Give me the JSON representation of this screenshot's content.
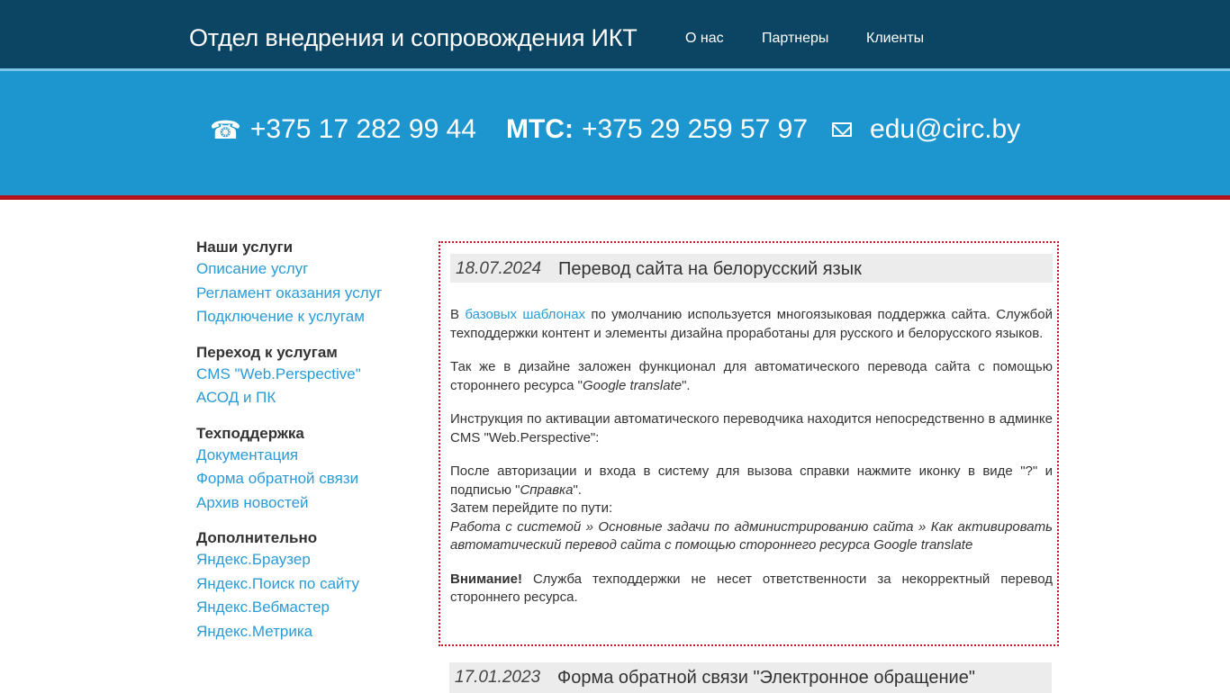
{
  "header": {
    "site_title": "Отдел внедрения и сопровождения ИКТ",
    "nav": [
      "О нас",
      "Партнеры",
      "Клиенты"
    ]
  },
  "contacts": {
    "phone": "+375 17 282 99 44",
    "mts_label": "МТС:",
    "mts_phone": "+375 29 259 57 97",
    "email": "edu@circ.by",
    "icons": [
      "phone-icon",
      "mail-icon"
    ]
  },
  "sidebar": {
    "groups": [
      {
        "heading": "Наши услуги",
        "links": [
          "Описание услуг",
          "Регламент оказания услуг",
          "Подключение к услугам"
        ]
      },
      {
        "heading": "Переход к услугам",
        "links": [
          "CMS \"Web.Perspective\"",
          "АСОД и ПК"
        ]
      },
      {
        "heading": "Техподдержка",
        "links": [
          "Документация",
          "Форма обратной связи",
          "Архив новостей"
        ]
      },
      {
        "heading": "Дополнительно",
        "links": [
          "Яндекс.Браузер",
          "Яндекс.Поиск по сайту",
          "Яндекс.Вебмастер",
          "Яндекс.Метрика"
        ]
      }
    ]
  },
  "news": [
    {
      "date": "18.07.2024",
      "title": "Перевод сайта на белорусский язык",
      "p1_pre": "В ",
      "p1_link": "базовых шаблонах",
      "p1_post": " по умолчанию используется многоязыковая поддержка сайта. Службой техподдержки контент и элементы дизайна проработаны для русского и белорусского языков.",
      "p2_pre": "Так же в дизайне заложен функционал для автоматического перевода сайта с помощью стороннего ресурса \"",
      "p2_em": "Google translate",
      "p2_post": "\".",
      "p3": "Инструкция по активации автоматического переводчика находится непосредственно в админке CMS \"Web.Perspective\":",
      "p4_pre": "После авторизации и входа в систему для вызова справки нажмите иконку в виде \"?\" и подписью \"",
      "p4_em": "Справка",
      "p4_post": "\".",
      "p4_line2": "Затем перейдите по пути:",
      "p4_path": "Работа с системой » Основные задачи по администрированию сайта » Как активировать автоматический перевод сайта с помощью стороннего ресурса Google translate",
      "p5_bold": "Внимание!",
      "p5_text": " Служба техподдержки не несет ответственности за некорректный перевод стороннего ресурса."
    },
    {
      "date": "17.01.2023",
      "title": "Форма обратной связи \"Электронное обращение\""
    }
  ]
}
